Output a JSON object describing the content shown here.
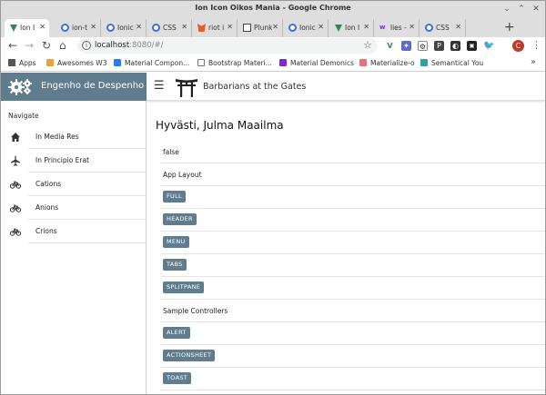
{
  "window": {
    "title": "Ion Icon Oikos Mania - Google Chrome",
    "controls": {
      "minimize": "⌄",
      "maximize": "⌃",
      "close": "✕"
    }
  },
  "tabs": [
    {
      "label": "Ion I",
      "icon": "vue-icon",
      "active": true
    },
    {
      "label": "ion-t",
      "icon": "globe-icon"
    },
    {
      "label": "Ionic",
      "icon": "globe-icon"
    },
    {
      "label": "CSS",
      "icon": "globe-icon"
    },
    {
      "label": "riot i",
      "icon": "fox-icon"
    },
    {
      "label": "Plunk",
      "icon": "download-icon"
    },
    {
      "label": "Ionic",
      "icon": "globe-icon"
    },
    {
      "label": "Ion I",
      "icon": "vue-icon"
    },
    {
      "label": "lies -",
      "icon": "w-icon"
    },
    {
      "label": "CSS",
      "icon": "globe-icon"
    }
  ],
  "new_tab": "+",
  "toolbar": {
    "url_host": "localhost",
    "url_rest": ":8080/#/",
    "back": "←",
    "forward": "→",
    "reload": "↻",
    "home": "⌂",
    "star": "☆",
    "profile_initial": "C",
    "menu": "⋮"
  },
  "bookmarks": [
    {
      "label": "Apps",
      "color": "#555555"
    },
    {
      "label": "Awesomes W3",
      "color": "#e8a33d"
    },
    {
      "label": "Material Compon...",
      "color": "#2979ff"
    },
    {
      "label": "Bootstrap Materi...",
      "color": "#777777"
    },
    {
      "label": "Material Demonics",
      "color": "#7b2bd1"
    },
    {
      "label": "Materialize-o",
      "color": "#ee6e73"
    },
    {
      "label": "Semantical You",
      "color": "#2ba3a3"
    }
  ],
  "bookmarks_more": "»",
  "app": {
    "brand": "Engenho de Despenho",
    "header_title": "Barbarians at the Gates",
    "accent": "#5f7d8e",
    "nav_label": "Navigate",
    "nav_items": [
      {
        "label": "In Media Res",
        "icon": "home-icon"
      },
      {
        "label": "In Principio Erat",
        "icon": "airplane-icon"
      },
      {
        "label": "Cations",
        "icon": "bicycle-icon"
      },
      {
        "label": "Anions",
        "icon": "bicycle-icon"
      },
      {
        "label": "Crions",
        "icon": "bicycle-icon"
      }
    ],
    "page_title": "Hyvästi, Julma Maailma",
    "rows": [
      {
        "type": "text",
        "text": "false"
      },
      {
        "type": "text",
        "text": "App Layout"
      },
      {
        "type": "chip",
        "text": "FULL"
      },
      {
        "type": "chip",
        "text": "HEADER"
      },
      {
        "type": "chip",
        "text": "MENU"
      },
      {
        "type": "chip",
        "text": "TABS"
      },
      {
        "type": "chip",
        "text": "SPLITPANE"
      },
      {
        "type": "text",
        "text": "Sample Controllers"
      },
      {
        "type": "chip",
        "text": "ALERT"
      },
      {
        "type": "chip",
        "text": "ACTIONSHEET"
      },
      {
        "type": "chip",
        "text": "TOAST"
      }
    ]
  }
}
